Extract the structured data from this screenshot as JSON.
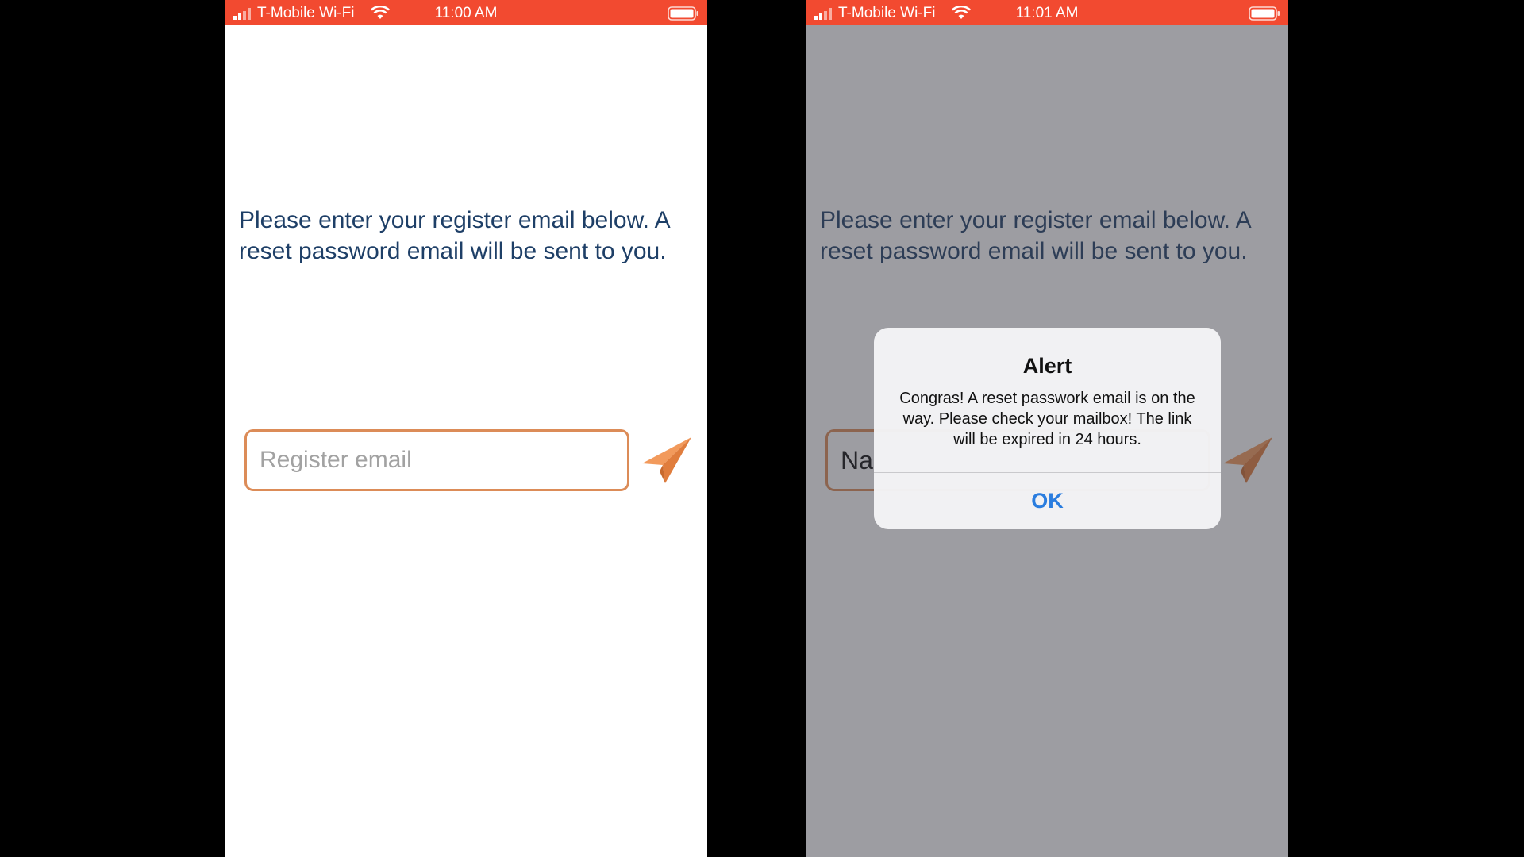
{
  "colors": {
    "status_bar": "#f24a30",
    "instruction_text": "#1e3f67",
    "field_border": "#dc8c58",
    "send_icon": "#ef8f52",
    "alert_button": "#2a7ddf"
  },
  "left_screen": {
    "status_bar": {
      "carrier": "T-Mobile Wi-Fi",
      "time": "11:00 AM"
    },
    "instructions": "Please enter your register email below. A reset password email will be sent to you.",
    "email_field": {
      "placeholder": "Register email",
      "value": ""
    },
    "send_icon": "paper-plane-icon"
  },
  "right_screen": {
    "status_bar": {
      "carrier": "T-Mobile Wi-Fi",
      "time": "11:01 AM"
    },
    "instructions": "Please enter your register email below. A reset password email will be sent to you.",
    "email_field": {
      "value": "Na"
    },
    "send_icon": "paper-plane-icon",
    "alert": {
      "title": "Alert",
      "message": "Congras! A reset passwork email is on the way. Please check your mailbox! The link will be expired in 24 hours.",
      "ok_label": "OK"
    }
  }
}
